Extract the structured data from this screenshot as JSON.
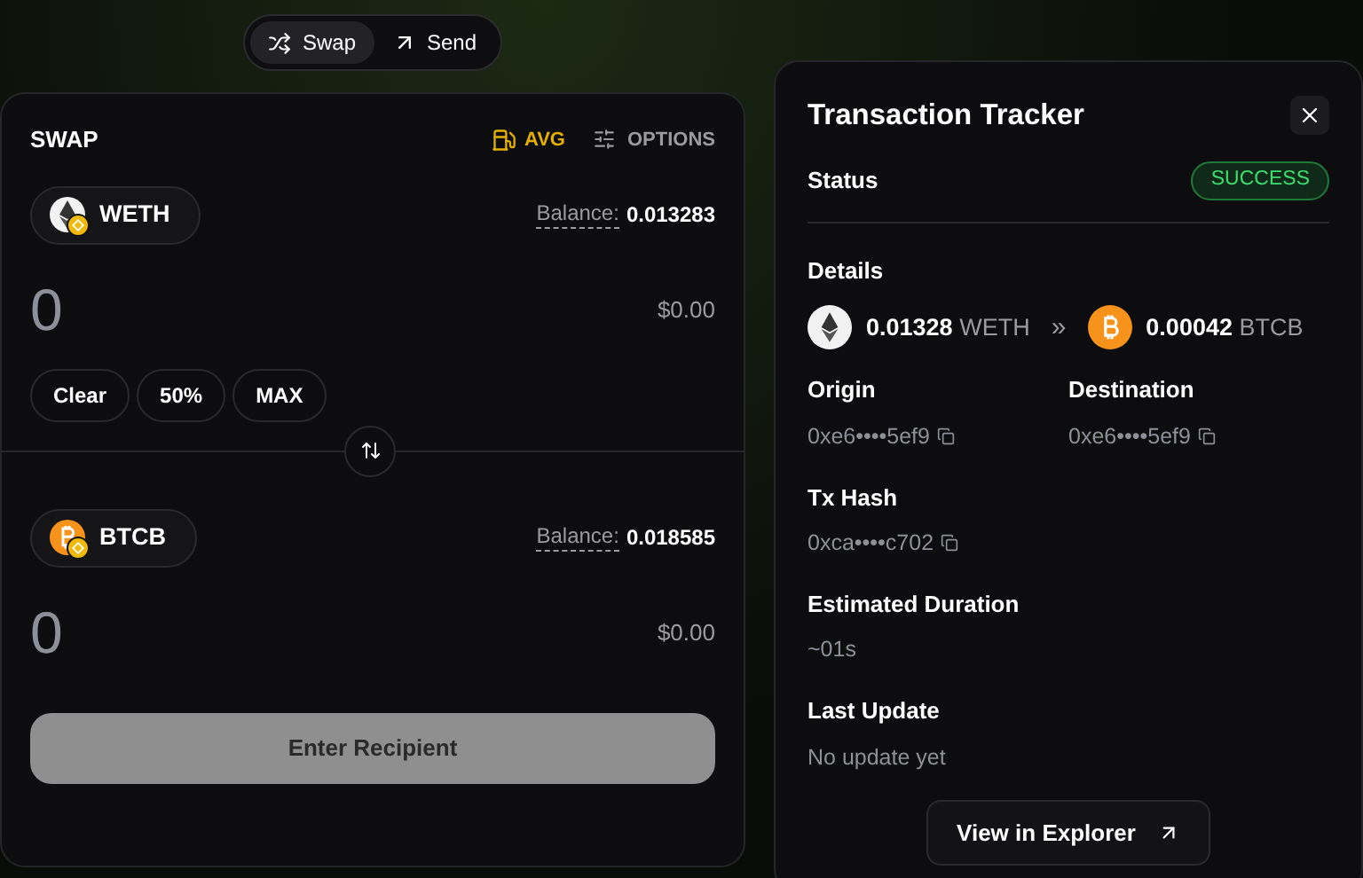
{
  "mode_tabs": [
    {
      "label": "Swap",
      "selected": true,
      "kind": "swap"
    },
    {
      "label": "Send",
      "selected": false,
      "kind": "send"
    }
  ],
  "swap": {
    "title": "SWAP",
    "gas": "AVG",
    "options": "OPTIONS",
    "tokens": [
      {
        "symbol": "WETH",
        "kind": "eth",
        "balance_label": "Balance:",
        "balance": "0.013283",
        "amount": "0",
        "usd": "$0.00",
        "quick": [
          "Clear",
          "50%",
          "MAX"
        ]
      },
      {
        "symbol": "BTCB",
        "kind": "btc",
        "balance_label": "Balance:",
        "balance": "0.018585",
        "amount": "0",
        "usd": "$0.00"
      }
    ],
    "submit": {
      "label": "Enter Recipient",
      "disabled": true
    }
  },
  "tracker": {
    "title": "Transaction Tracker",
    "status_label": "Status",
    "status": "SUCCESS",
    "details_label": "Details",
    "from": {
      "amount": "0.01328",
      "symbol": "WETH",
      "kind": "eth"
    },
    "separator": "»",
    "to": {
      "amount": "0.00042",
      "symbol": "BTCB",
      "kind": "btc"
    },
    "fields": [
      {
        "label": "Origin",
        "value": "0xe6••••5ef9",
        "copy": true
      },
      {
        "label": "Destination",
        "value": "0xe6••••5ef9",
        "copy": true
      },
      {
        "label": "Tx Hash",
        "value": "0xca••••c702",
        "copy": true
      },
      {
        "label": "Estimated Duration",
        "value": "~01s",
        "copy": false
      },
      {
        "label": "Last Update",
        "value": "No update yet",
        "copy": false
      }
    ],
    "explorer": "View in Explorer"
  }
}
